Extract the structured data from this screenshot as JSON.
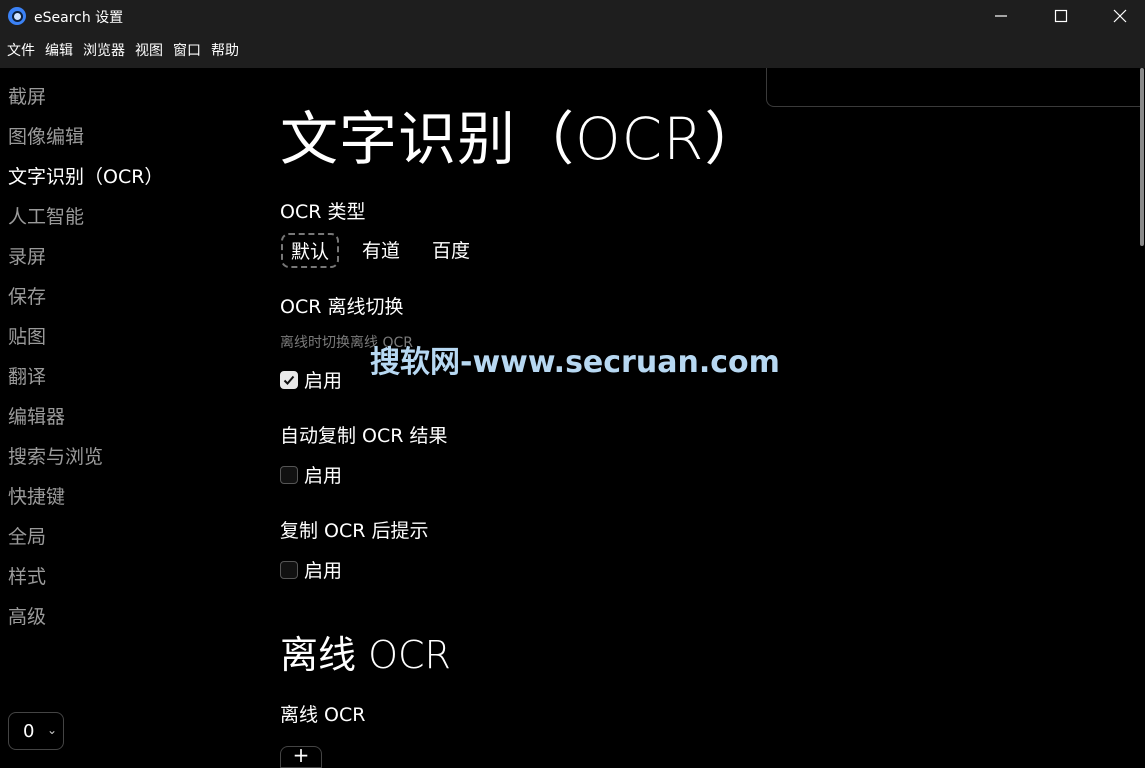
{
  "window": {
    "title": "eSearch 设置"
  },
  "menu": [
    "文件",
    "编辑",
    "浏览器",
    "视图",
    "窗口",
    "帮助"
  ],
  "sidebar": {
    "items": [
      {
        "label": "截屏",
        "active": false
      },
      {
        "label": "图像编辑",
        "active": false
      },
      {
        "label": "文字识别（OCR）",
        "active": true
      },
      {
        "label": "人工智能",
        "active": false
      },
      {
        "label": "录屏",
        "active": false
      },
      {
        "label": "保存",
        "active": false
      },
      {
        "label": "贴图",
        "active": false
      },
      {
        "label": "翻译",
        "active": false
      },
      {
        "label": "编辑器",
        "active": false
      },
      {
        "label": "搜索与浏览",
        "active": false
      },
      {
        "label": "快捷键",
        "active": false
      },
      {
        "label": "全局",
        "active": false
      },
      {
        "label": "样式",
        "active": false
      },
      {
        "label": "高级",
        "active": false
      }
    ],
    "select_value": "0"
  },
  "main": {
    "heading": "文字识别（OCR）",
    "ocr_type": {
      "label": "OCR 类型",
      "options": [
        "默认",
        "有道",
        "百度"
      ],
      "selected": "默认"
    },
    "offline_switch": {
      "label": "OCR 离线切换",
      "description": "离线时切换离线 OCR",
      "checkbox_label": "启用",
      "checked": true
    },
    "auto_copy": {
      "label": "自动复制 OCR 结果",
      "checkbox_label": "启用",
      "checked": false
    },
    "copy_tip": {
      "label": "复制 OCR 后提示",
      "checkbox_label": "启用",
      "checked": false
    },
    "offline_heading": "离线 OCR",
    "offline_ocr_label": "离线 OCR",
    "add_button": "+"
  },
  "watermark": "搜软网-www.secruan.com"
}
